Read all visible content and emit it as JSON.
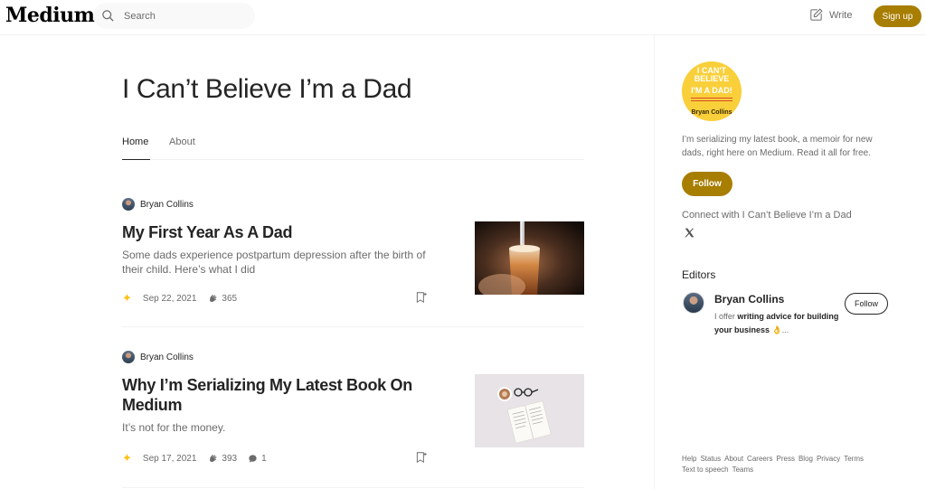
{
  "header": {
    "logo": "Medium",
    "search_placeholder": "Search",
    "write_label": "Write",
    "signup_label": "Sign up"
  },
  "publication": {
    "title": "I Can’t Believe I’m a Dad",
    "tabs": [
      {
        "label": "Home",
        "active": true
      },
      {
        "label": "About",
        "active": false
      }
    ]
  },
  "posts": [
    {
      "author": "Bryan Collins",
      "title": "My First Year As A Dad",
      "subtitle": "Some dads experience postpartum depression after the birth of their child. Here’s what I did",
      "date": "Sep 22, 2021",
      "claps": "365",
      "responses": "",
      "thumbnail": "glass-of-beer-tap"
    },
    {
      "author": "Bryan Collins",
      "title": "Why I’m Serializing My Latest Book On Medium",
      "subtitle": "It’s not for the money.",
      "date": "Sep 17, 2021",
      "claps": "393",
      "responses": "1",
      "thumbnail": "open-book-coffee-glasses"
    }
  ],
  "sidebar": {
    "logo_text": {
      "line1": "I CAN'T BELIEVE",
      "line2": "I'M A DAD!",
      "author": "Bryan Collins"
    },
    "description": "I’m serializing my latest book, a memoir for new dads, right here on Medium. Read it all for free.",
    "follow_label": "Follow",
    "connect_label": "Connect with I Can’t Believe I’m a Dad",
    "editors_heading": "Editors",
    "editor": {
      "name": "Bryan Collins",
      "bio_prefix": "I offer ",
      "bio_bold": "writing advice for building your business",
      "bio_suffix": " 👌...",
      "follow_label": "Follow"
    },
    "footer_links": [
      "Help",
      "Status",
      "About",
      "Careers",
      "Press",
      "Blog",
      "Privacy",
      "Terms",
      "Text to speech",
      "Teams"
    ]
  },
  "colors": {
    "accent": "#a77e00",
    "text": "#242424",
    "muted": "#6b6b6b",
    "star": "#ffc017",
    "logo_bg": "#f9cf3a"
  }
}
